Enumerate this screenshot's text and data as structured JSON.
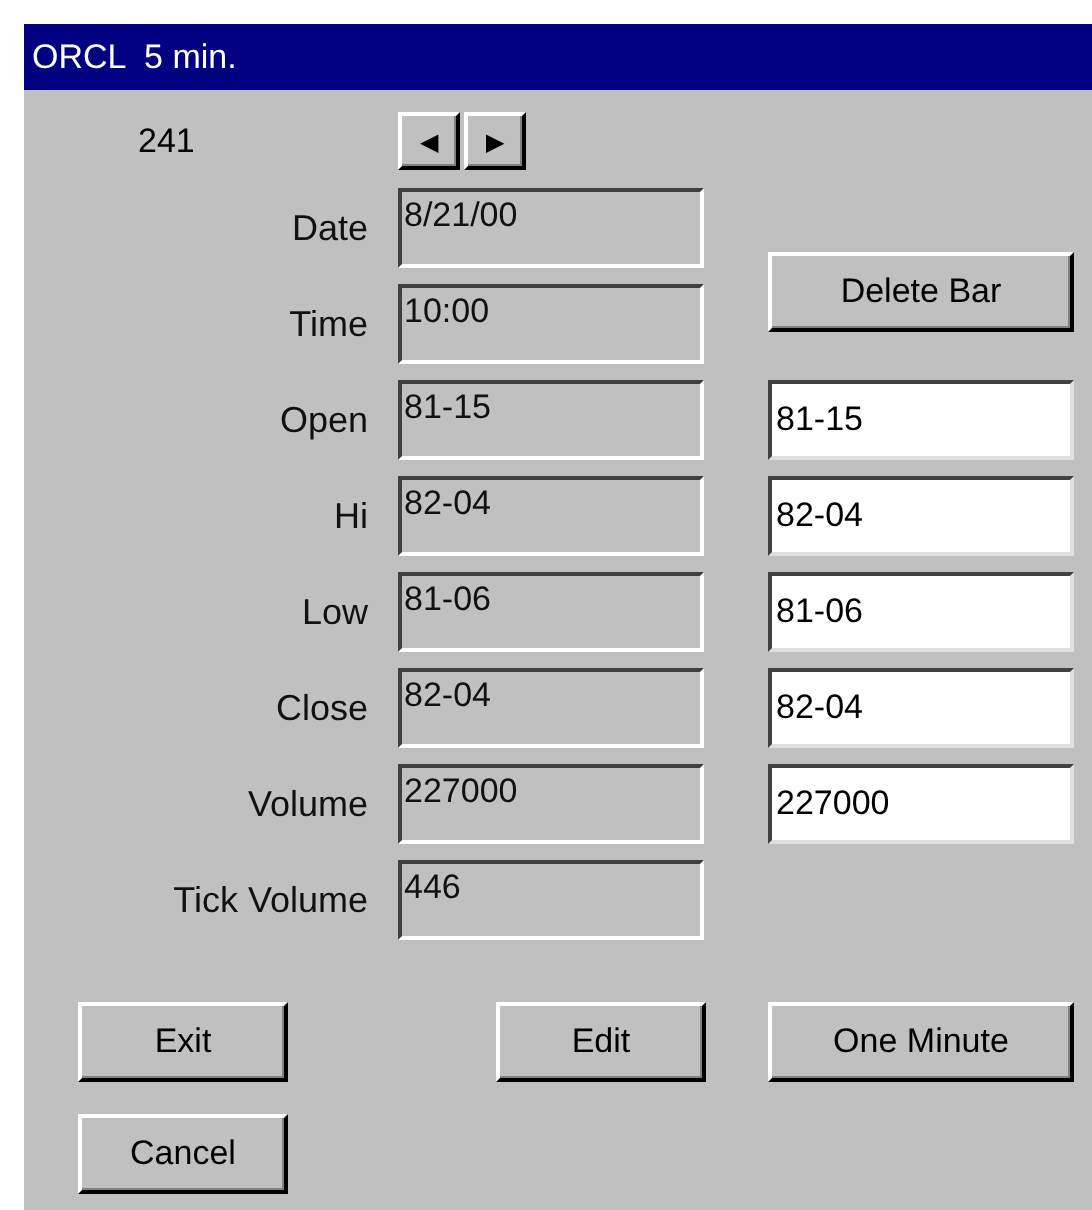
{
  "window": {
    "title": "ORCL  5 min."
  },
  "record_number": "241",
  "nav_buttons": [
    "◀",
    "▶"
  ],
  "delete_button": "Delete Bar",
  "fields": [
    {
      "label": "Date",
      "value": "8/21/00"
    },
    {
      "label": "Time",
      "value": "10:00"
    },
    {
      "label": "Open",
      "value": "81-15",
      "edit_value": "81-15"
    },
    {
      "label": "Hi",
      "value": "82-04",
      "edit_value": "82-04"
    },
    {
      "label": "Low",
      "value": "81-06",
      "edit_value": "81-06"
    },
    {
      "label": "Close",
      "value": "82-04",
      "edit_value": "82-04"
    },
    {
      "label": "Volume",
      "value": "227000",
      "edit_value": "227000"
    },
    {
      "label": "Tick Volume",
      "value": "446"
    }
  ],
  "buttons": [
    "Exit",
    "Edit",
    "One Minute",
    "Cancel"
  ]
}
